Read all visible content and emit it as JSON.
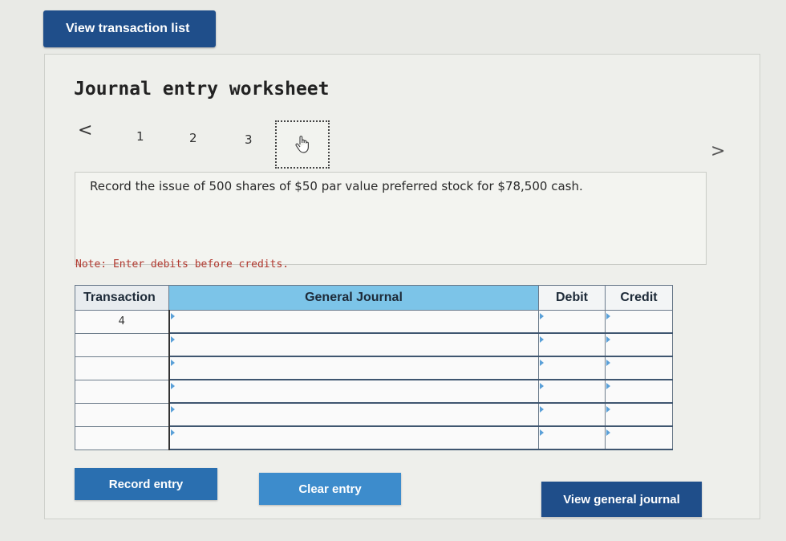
{
  "header": {
    "view_transaction_list_label": "View transaction list"
  },
  "worksheet": {
    "title": "Journal entry worksheet",
    "nav": {
      "prev_glyph": "<",
      "next_glyph": ">",
      "steps": [
        "1",
        "2",
        "3"
      ],
      "current_step_icon": "hand-pointer-icon"
    },
    "description": "Record the issue of 500 shares of $50 par value preferred stock for $78,500 cash.",
    "note": "Note: Enter debits before credits."
  },
  "journal_table": {
    "headers": {
      "transaction": "Transaction",
      "general_journal": "General Journal",
      "debit": "Debit",
      "credit": "Credit"
    },
    "rows": [
      {
        "transaction": "4",
        "account": "",
        "debit": "",
        "credit": ""
      },
      {
        "transaction": "",
        "account": "",
        "debit": "",
        "credit": ""
      },
      {
        "transaction": "",
        "account": "",
        "debit": "",
        "credit": ""
      },
      {
        "transaction": "",
        "account": "",
        "debit": "",
        "credit": ""
      },
      {
        "transaction": "",
        "account": "",
        "debit": "",
        "credit": ""
      },
      {
        "transaction": "",
        "account": "",
        "debit": "",
        "credit": ""
      }
    ]
  },
  "buttons": {
    "record_entry": "Record entry",
    "clear_entry": "Clear entry",
    "view_general_journal": "View general journal"
  },
  "colors": {
    "primary_button": "#1f4e8a",
    "header_highlight": "#7cc4e8",
    "note_text": "#b0382e"
  }
}
